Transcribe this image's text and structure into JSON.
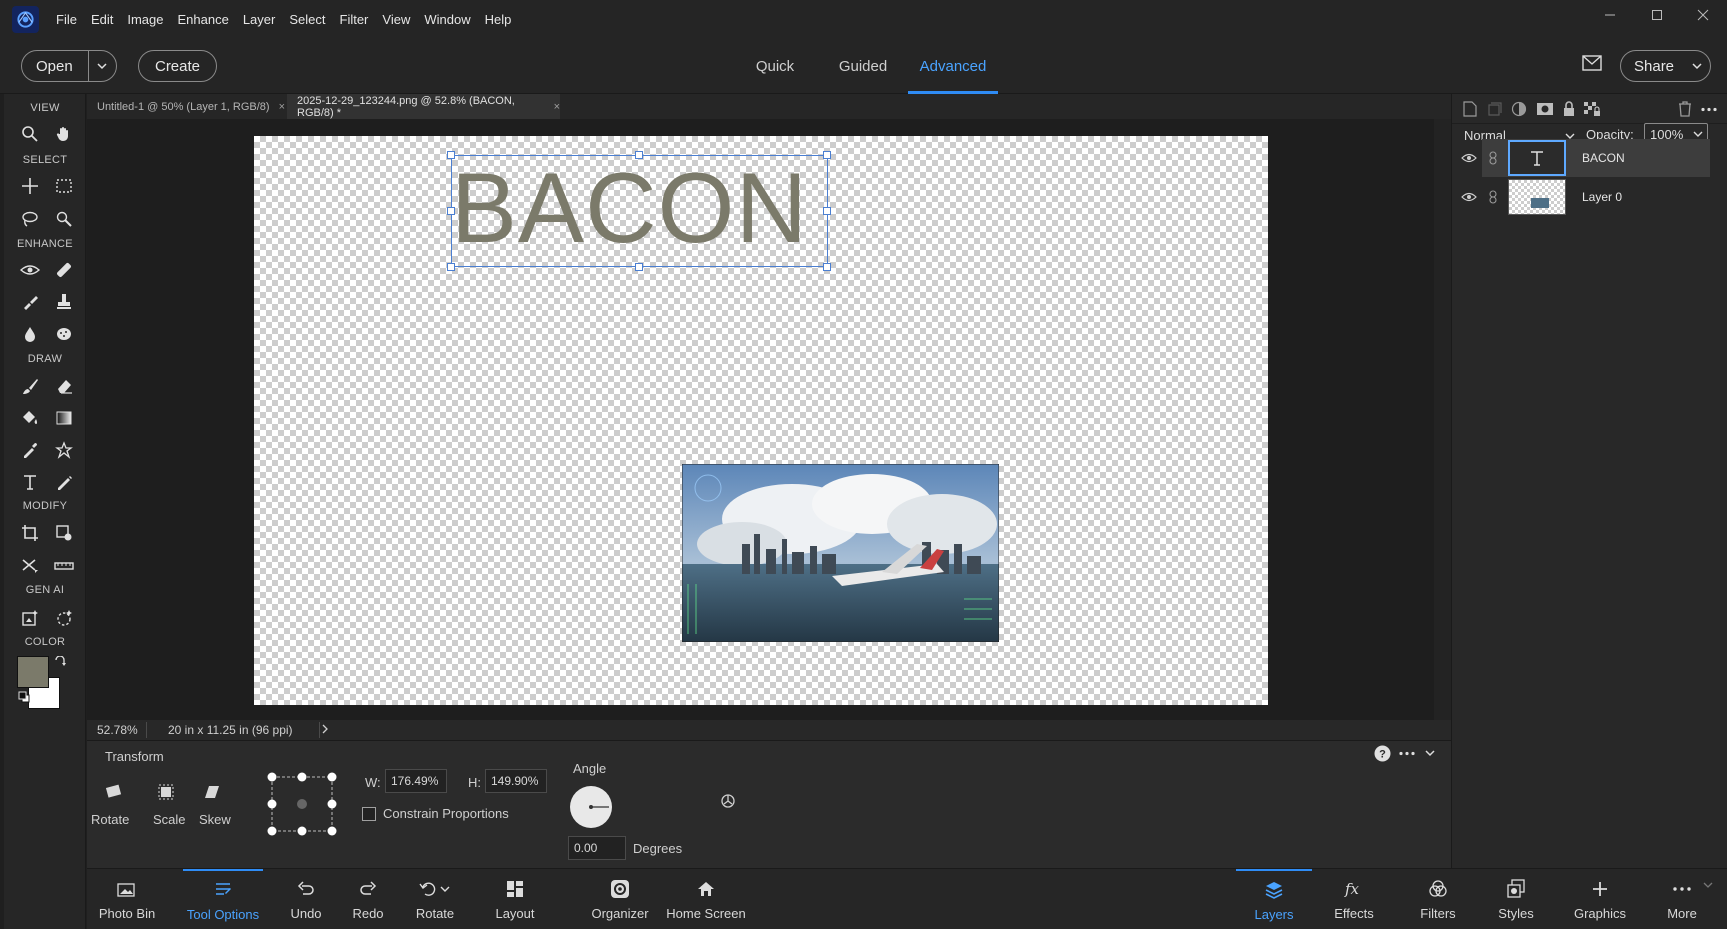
{
  "menubar": {
    "items": [
      "File",
      "Edit",
      "Image",
      "Enhance",
      "Layer",
      "Select",
      "Filter",
      "View",
      "Window",
      "Help"
    ]
  },
  "topbar": {
    "open_label": "Open",
    "create_label": "Create",
    "modes": [
      "Quick",
      "Guided",
      "Advanced"
    ],
    "active_mode": "Advanced",
    "share_label": "Share"
  },
  "tools": {
    "sections": [
      "VIEW",
      "SELECT",
      "ENHANCE",
      "DRAW",
      "MODIFY",
      "GEN AI",
      "COLOR"
    ]
  },
  "colors": {
    "foreground": "#7b7a6a",
    "background": "#ffffff",
    "accent": "#2f8cf5",
    "text_layer": "#7b7a6a"
  },
  "doc_tabs": [
    {
      "label": "Untitled-1 @ 50% (Layer 1, RGB/8)",
      "active": false
    },
    {
      "label": "2025-12-29_123244.png @ 52.8% (BACON, RGB/8) *",
      "active": true
    }
  ],
  "canvas": {
    "text_layer_content": "BACON"
  },
  "status": {
    "zoom": "52.78%",
    "doc_size": "20 in x 11.25 in (96 ppi)"
  },
  "tool_options": {
    "title": "Transform",
    "modes": [
      "Rotate",
      "Scale",
      "Skew"
    ],
    "w_label": "W:",
    "w_value": "176.49%",
    "h_label": "H:",
    "h_value": "149.90%",
    "constrain_label": "Constrain Proportions",
    "angle_label": "Angle",
    "angle_value": "0.00",
    "degrees_label": "Degrees"
  },
  "bottombar": {
    "left_items": [
      "Photo Bin",
      "Tool Options",
      "Undo",
      "Redo",
      "Rotate",
      "Layout",
      "Organizer",
      "Home Screen"
    ],
    "right_items": [
      "Layers",
      "Effects",
      "Filters",
      "Styles",
      "Graphics",
      "More"
    ]
  },
  "layers_panel": {
    "blend_mode": "Normal",
    "opacity_label": "Opacity:",
    "opacity_value": "100%",
    "layers": [
      {
        "name": "BACON",
        "selected": true
      },
      {
        "name": "Layer 0",
        "selected": false
      }
    ]
  }
}
